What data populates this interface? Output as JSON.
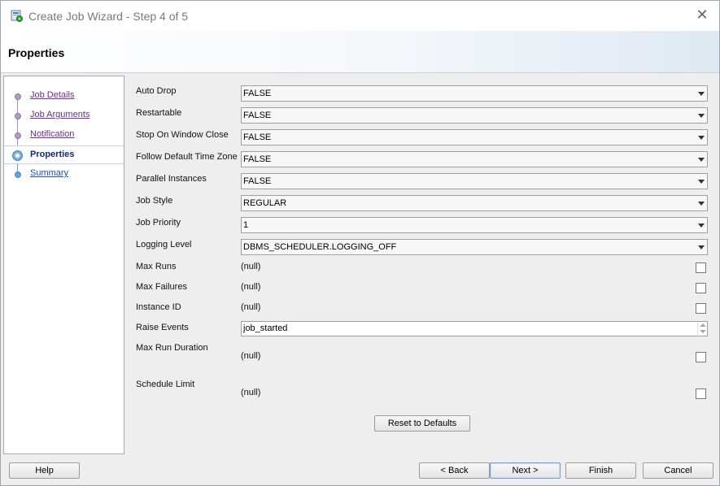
{
  "window": {
    "title": "Create Job Wizard - Step 4 of 5"
  },
  "header": {
    "title": "Properties"
  },
  "steps": [
    {
      "label": "Job Details",
      "state": "done"
    },
    {
      "label": "Job Arguments",
      "state": "done"
    },
    {
      "label": "Notification",
      "state": "done"
    },
    {
      "label": "Properties",
      "state": "current"
    },
    {
      "label": "Summary",
      "state": "future"
    }
  ],
  "properties": {
    "auto_drop": {
      "label": "Auto Drop",
      "value": "FALSE"
    },
    "restartable": {
      "label": "Restartable",
      "value": "FALSE"
    },
    "stop_on_window_close": {
      "label": "Stop On Window Close",
      "value": "FALSE"
    },
    "follow_default_time_zone": {
      "label": "Follow Default Time Zone",
      "value": "FALSE"
    },
    "parallel_instances": {
      "label": "Parallel Instances",
      "value": "FALSE"
    },
    "job_style": {
      "label": "Job Style",
      "value": "REGULAR"
    },
    "job_priority": {
      "label": "Job Priority",
      "value": "1"
    },
    "logging_level": {
      "label": "Logging Level",
      "value": "DBMS_SCHEDULER.LOGGING_OFF"
    },
    "max_runs": {
      "label": "Max Runs",
      "value": "(null)",
      "checked": false
    },
    "max_failures": {
      "label": "Max Failures",
      "value": "(null)",
      "checked": false
    },
    "instance_id": {
      "label": "Instance ID",
      "value": "(null)",
      "checked": false
    },
    "raise_events": {
      "label": "Raise Events",
      "value": "job_started"
    },
    "max_run_duration": {
      "label": "Max Run Duration",
      "value": "(null)",
      "checked": false
    },
    "schedule_limit": {
      "label": "Schedule Limit",
      "value": "(null)",
      "checked": false
    }
  },
  "buttons": {
    "reset": "Reset to Defaults",
    "help": "Help",
    "back": "< Back",
    "next": "Next >",
    "finish": "Finish",
    "cancel": "Cancel"
  }
}
